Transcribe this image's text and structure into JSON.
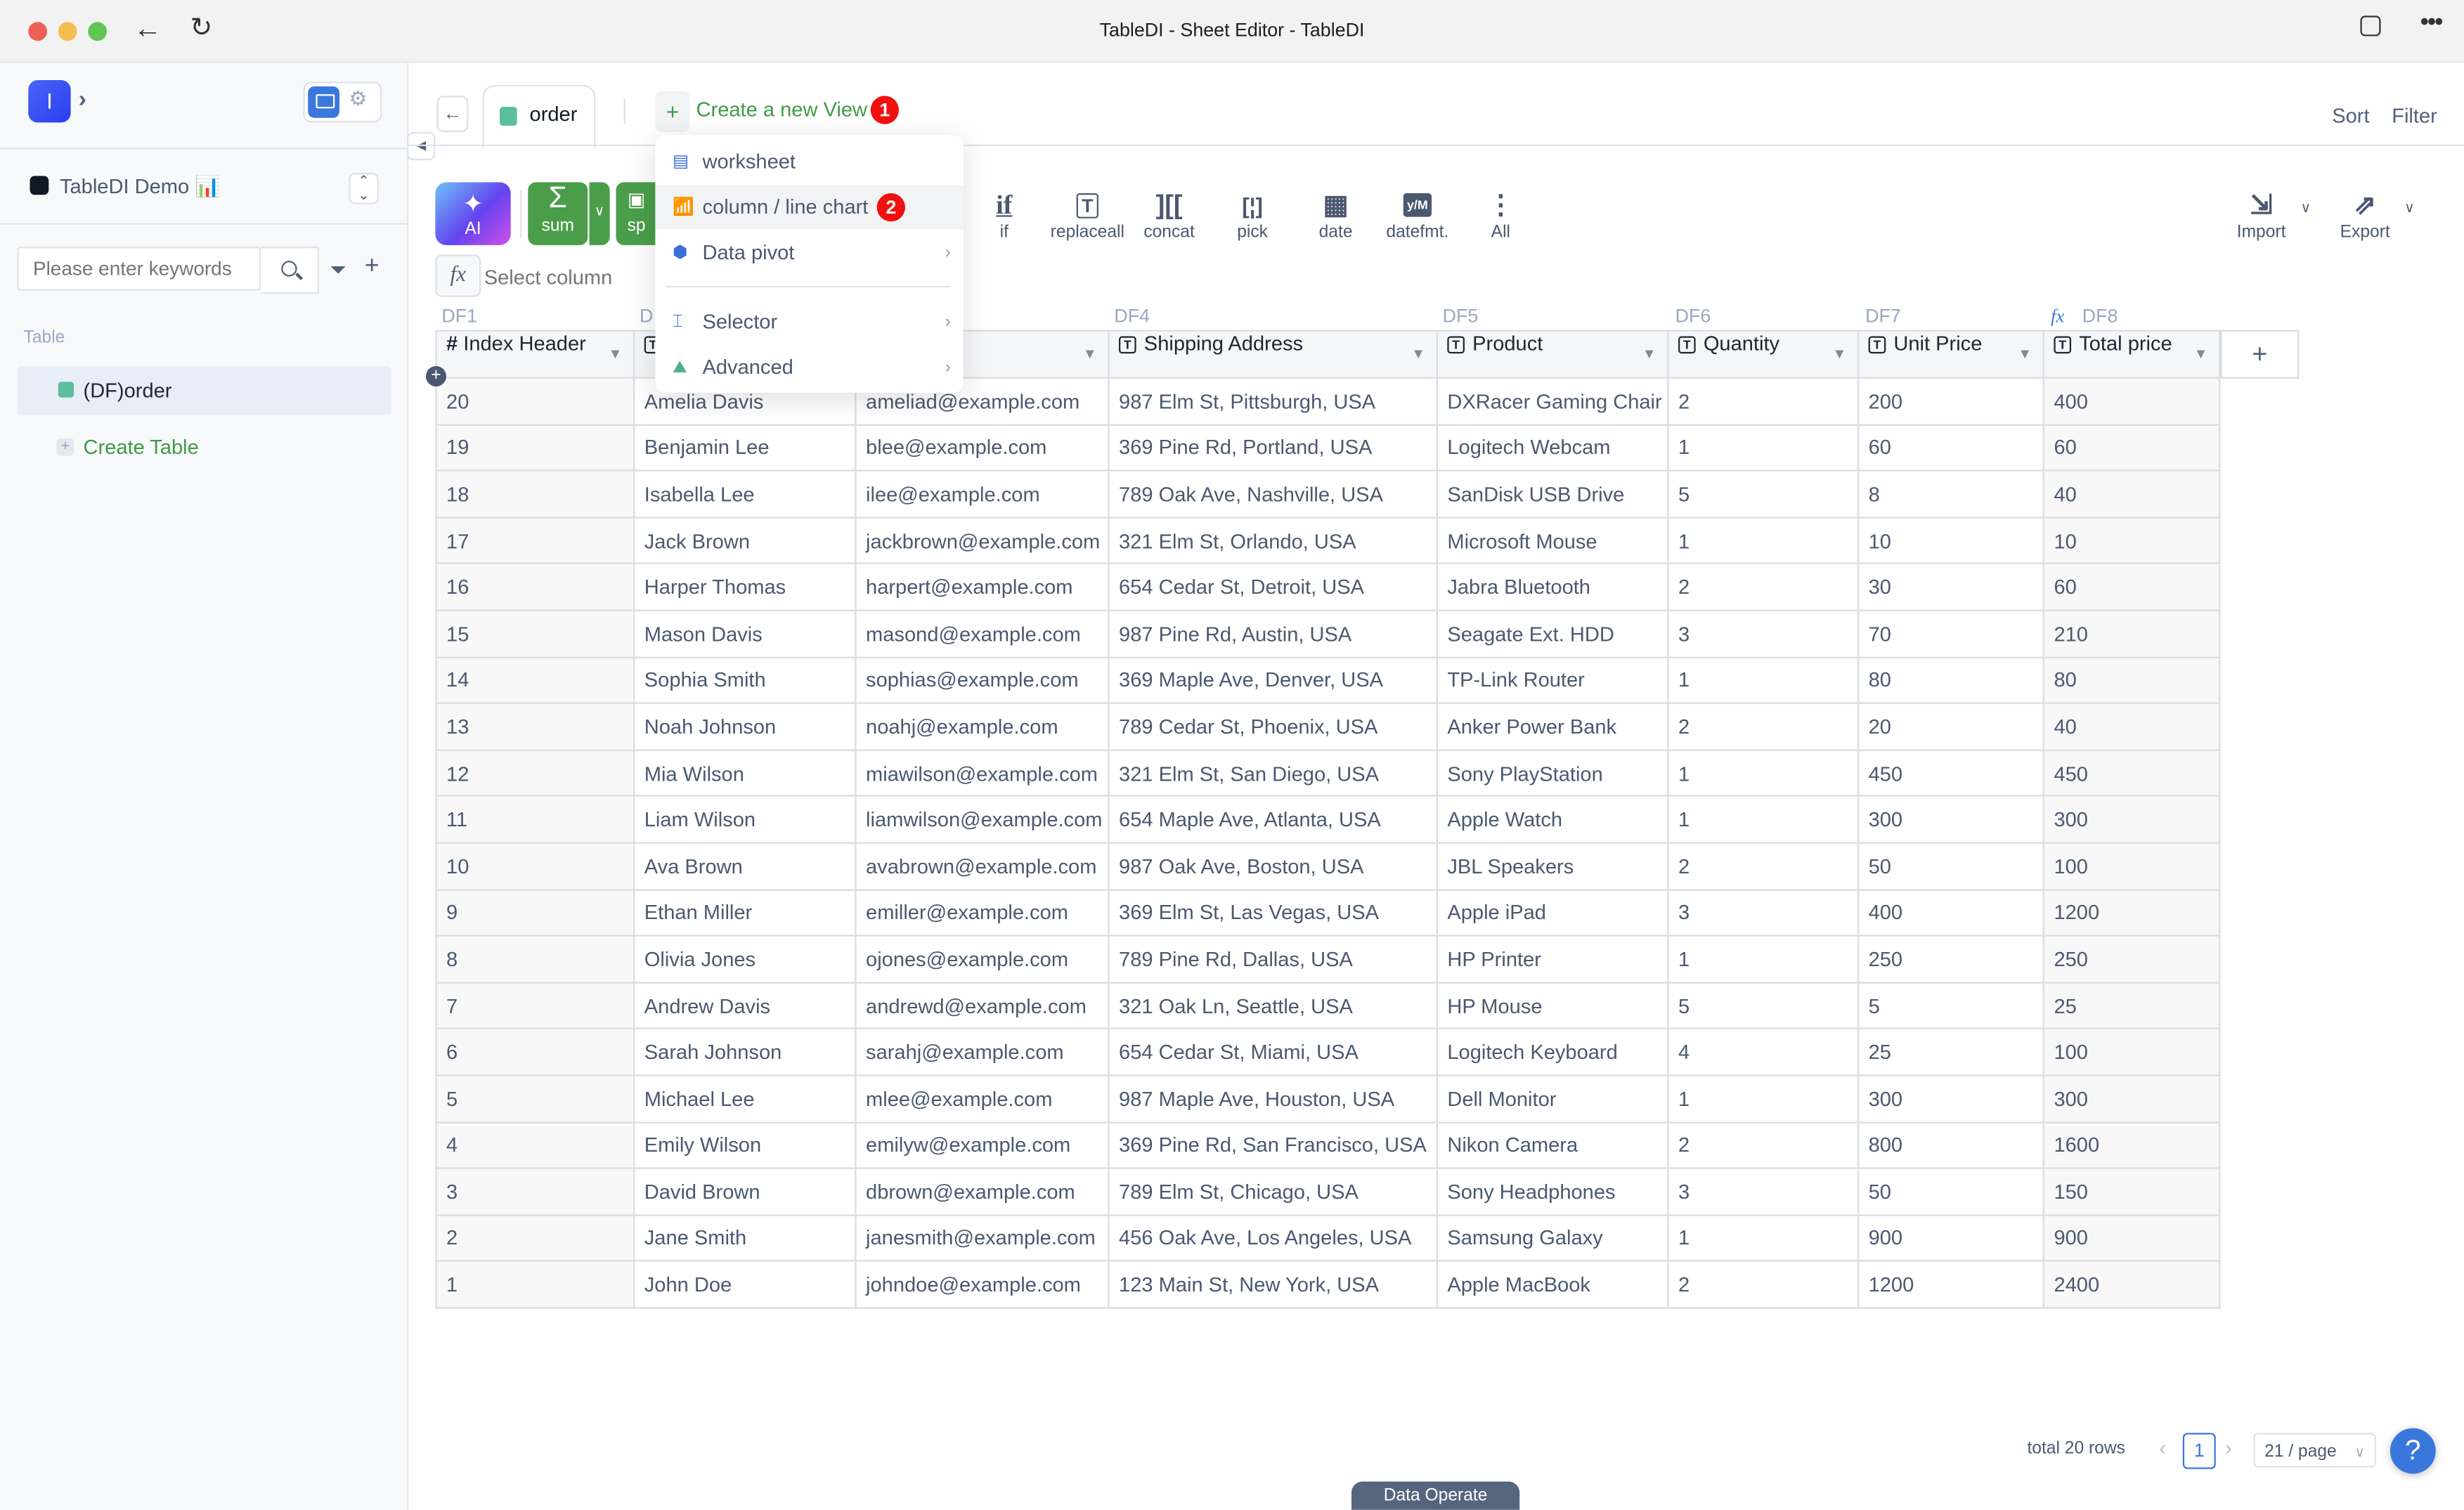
{
  "window": {
    "title": "TableDI - Sheet Editor - TableDI",
    "traffic_lights": {
      "close": "#ee5f56",
      "minimize": "#f5bf4f",
      "maximize": "#61c554"
    }
  },
  "sidebar": {
    "app_initial": "I",
    "workspace_name": "TableDI Demo 📊",
    "search_placeholder": "Please enter keywords",
    "section_label": "Table",
    "tables": [
      {
        "label": "(DF)order",
        "selected": true
      }
    ],
    "create_table_label": "Create Table"
  },
  "tabs": {
    "active": "order",
    "create_view_label": "Create a new View",
    "create_view_badge": "1",
    "sort_label": "Sort",
    "filter_label": "Filter"
  },
  "view_menu": {
    "items": [
      {
        "label": "worksheet",
        "icon": "worksheet-icon",
        "submenu": false
      },
      {
        "label": "column / line chart",
        "icon": "chart-icon",
        "submenu": false,
        "highlighted": true,
        "badge": "2"
      },
      {
        "label": "Data pivot",
        "icon": "cube-icon",
        "submenu": true
      },
      {
        "label": "Selector",
        "icon": "selector-icon",
        "submenu": true
      },
      {
        "label": "Advanced",
        "icon": "advanced-icon",
        "submenu": true
      }
    ]
  },
  "toolbar": {
    "ai_label": "AI",
    "sum_label": "sum",
    "split_label": "sp",
    "tools": [
      {
        "label": "if",
        "icon": "if"
      },
      {
        "label": "replaceall",
        "icon": "T⇄"
      },
      {
        "label": "concat",
        "icon": "][["
      },
      {
        "label": "pick",
        "icon": "[¦]"
      },
      {
        "label": "date",
        "icon": "▦"
      },
      {
        "label": "datefmt.",
        "icon": "y/M"
      },
      {
        "label": "All",
        "icon": "⋮"
      }
    ],
    "import_label": "Import",
    "export_label": "Export",
    "formula_placeholder": "Select column"
  },
  "table": {
    "df_labels": [
      "DF1",
      "D",
      "DF4",
      "DF5",
      "DF6",
      "DF7",
      "DF8"
    ],
    "columns": [
      {
        "label": "Index Header",
        "type": "#"
      },
      {
        "label": "",
        "type": "T"
      },
      {
        "label": "",
        "type": ""
      },
      {
        "label": "Shipping Address",
        "type": "T"
      },
      {
        "label": "Product",
        "type": "T"
      },
      {
        "label": "Quantity",
        "type": "T"
      },
      {
        "label": "Unit Price",
        "type": "T"
      },
      {
        "label": "Total price",
        "type": "T"
      }
    ],
    "rows": [
      [
        "20",
        "Amelia Davis",
        "ameliad@example.com",
        "987 Elm St, Pittsburgh, USA",
        "DXRacer Gaming Chair",
        "2",
        "200",
        "400"
      ],
      [
        "19",
        "Benjamin Lee",
        "blee@example.com",
        "369 Pine Rd, Portland, USA",
        "Logitech Webcam",
        "1",
        "60",
        "60"
      ],
      [
        "18",
        "Isabella Lee",
        "ilee@example.com",
        "789 Oak Ave, Nashville, USA",
        "SanDisk USB Drive",
        "5",
        "8",
        "40"
      ],
      [
        "17",
        "Jack Brown",
        "jackbrown@example.com",
        "321 Elm St, Orlando, USA",
        "Microsoft Mouse",
        "1",
        "10",
        "10"
      ],
      [
        "16",
        "Harper Thomas",
        "harpert@example.com",
        "654 Cedar St, Detroit, USA",
        "Jabra Bluetooth",
        "2",
        "30",
        "60"
      ],
      [
        "15",
        "Mason Davis",
        "masond@example.com",
        "987 Pine Rd, Austin, USA",
        "Seagate Ext. HDD",
        "3",
        "70",
        "210"
      ],
      [
        "14",
        "Sophia Smith",
        "sophias@example.com",
        "369 Maple Ave, Denver, USA",
        "TP-Link Router",
        "1",
        "80",
        "80"
      ],
      [
        "13",
        "Noah Johnson",
        "noahj@example.com",
        "789 Cedar St, Phoenix, USA",
        "Anker Power Bank",
        "2",
        "20",
        "40"
      ],
      [
        "12",
        "Mia Wilson",
        "miawilson@example.com",
        "321 Elm St, San Diego, USA",
        "Sony PlayStation",
        "1",
        "450",
        "450"
      ],
      [
        "11",
        "Liam Wilson",
        "liamwilson@example.com",
        "654 Maple Ave, Atlanta, USA",
        "Apple Watch",
        "1",
        "300",
        "300"
      ],
      [
        "10",
        "Ava Brown",
        "avabrown@example.com",
        "987 Oak Ave, Boston, USA",
        "JBL Speakers",
        "2",
        "50",
        "100"
      ],
      [
        "9",
        "Ethan Miller",
        "emiller@example.com",
        "369 Elm St, Las Vegas, USA",
        "Apple iPad",
        "3",
        "400",
        "1200"
      ],
      [
        "8",
        "Olivia Jones",
        "ojones@example.com",
        "789 Pine Rd, Dallas, USA",
        "HP Printer",
        "1",
        "250",
        "250"
      ],
      [
        "7",
        "Andrew Davis",
        "andrewd@example.com",
        "321 Oak Ln, Seattle, USA",
        "HP Mouse",
        "5",
        "5",
        "25"
      ],
      [
        "6",
        "Sarah Johnson",
        "sarahj@example.com",
        "654 Cedar St, Miami, USA",
        "Logitech Keyboard",
        "4",
        "25",
        "100"
      ],
      [
        "5",
        "Michael Lee",
        "mlee@example.com",
        "987 Maple Ave, Houston, USA",
        "Dell Monitor",
        "1",
        "300",
        "300"
      ],
      [
        "4",
        "Emily Wilson",
        "emilyw@example.com",
        "369 Pine Rd, San Francisco, USA",
        "Nikon Camera",
        "2",
        "800",
        "1600"
      ],
      [
        "3",
        "David Brown",
        "dbrown@example.com",
        "789 Elm St, Chicago, USA",
        "Sony Headphones",
        "3",
        "50",
        "150"
      ],
      [
        "2",
        "Jane Smith",
        "janesmith@example.com",
        "456 Oak Ave, Los Angeles, USA",
        "Samsung Galaxy",
        "1",
        "900",
        "900"
      ],
      [
        "1",
        "John Doe",
        "johndoe@example.com",
        "123 Main St, New York, USA",
        "Apple MacBook",
        "2",
        "1200",
        "2400"
      ]
    ]
  },
  "footer": {
    "total_rows": "total 20 rows",
    "current_page": "1",
    "page_size": "21 / page",
    "help": "?",
    "data_operate": "Data Operate"
  }
}
